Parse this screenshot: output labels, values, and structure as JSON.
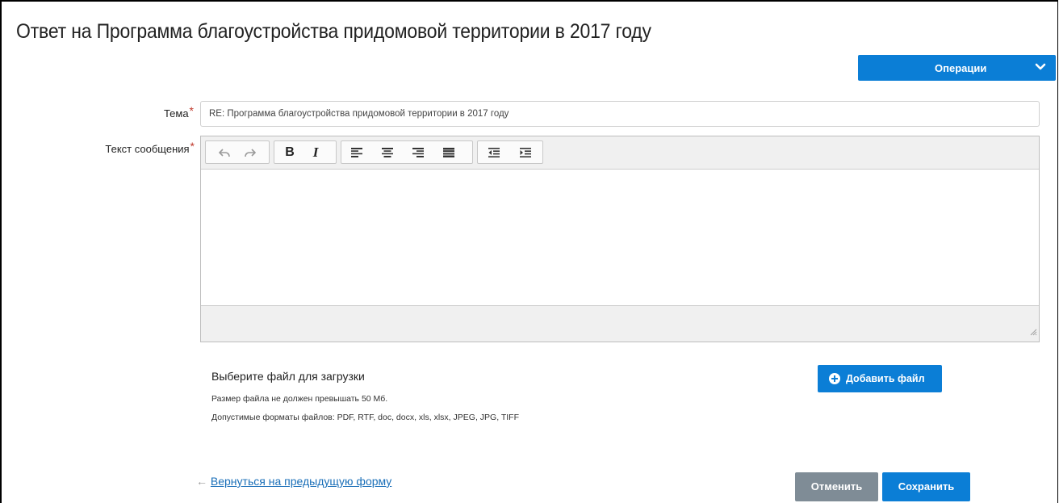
{
  "page": {
    "title": "Ответ на Программа благоустройства придомовой территории в 2017 году"
  },
  "operations": {
    "label": "Операции",
    "icon": "chevron-down-icon"
  },
  "form": {
    "subject": {
      "label": "Тема",
      "required_mark": "*",
      "value": "RE: Программа благоустройства придомовой территории в 2017 году"
    },
    "message": {
      "label": "Текст сообщения",
      "required_mark": "*",
      "toolbar": [
        "undo-icon",
        "redo-icon",
        "bold-icon",
        "italic-icon",
        "align-left-icon",
        "align-center-icon",
        "align-right-icon",
        "align-justify-icon",
        "outdent-icon",
        "indent-icon"
      ],
      "bold_glyph": "B",
      "italic_glyph": "I"
    }
  },
  "upload": {
    "title": "Выберите файл для загрузки",
    "size_note": "Размер файла не должен превышать 50 Мб.",
    "formats_note": "Допустимые форматы файлов: PDF, RTF, doc, docx, xls, xlsx, JPEG, JPG, TIFF",
    "add_button": "Добавить файл"
  },
  "footer": {
    "back_arrow": "←",
    "back_link": "Вернуться на предыдущую форму",
    "cancel": "Отменить",
    "save": "Сохранить"
  },
  "colors": {
    "primary": "#0b7ed6",
    "secondary": "#7f8c96",
    "required": "#c0392b",
    "link": "#1a6fb8"
  }
}
